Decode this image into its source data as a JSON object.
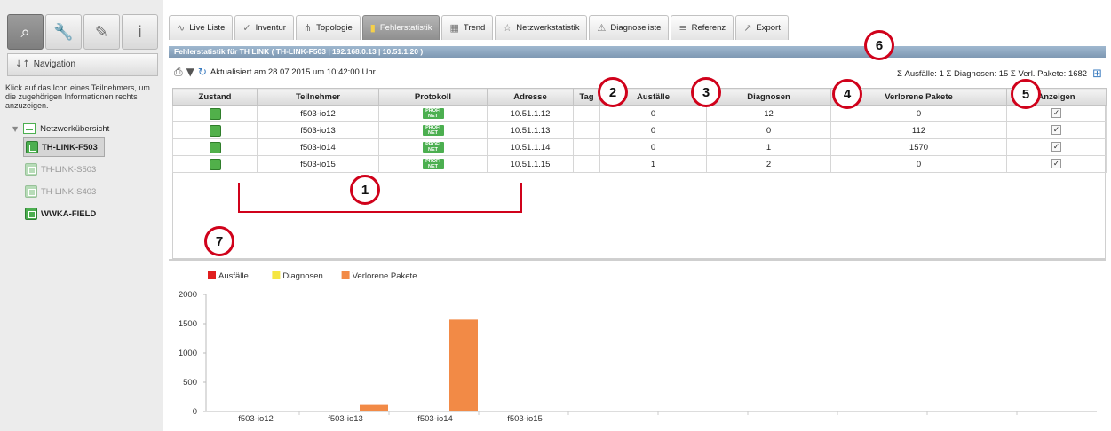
{
  "left_panel": {
    "tools": [
      {
        "icon": "search-icon",
        "glyph": "⌕"
      },
      {
        "icon": "wrench-icon",
        "glyph": "🔧"
      },
      {
        "icon": "tag-icon",
        "glyph": "✎"
      },
      {
        "icon": "info-icon",
        "glyph": "i"
      }
    ],
    "navigation_title": "Navigation",
    "hint": "Klick auf das Icon eines Teilnehmers, um die zugehörigen Informationen rechts anzuzeigen.",
    "tree_root": "Netzwerkübersicht",
    "nodes": [
      {
        "label": "TH-LINK-F503",
        "selected": true,
        "dim": false
      },
      {
        "label": "TH-LINK-S503",
        "selected": false,
        "dim": true
      },
      {
        "label": "TH-LINK-S403",
        "selected": false,
        "dim": true
      },
      {
        "label": "WWKA-FIELD",
        "selected": false,
        "dim": false
      }
    ]
  },
  "tabs": [
    {
      "label": "Live Liste",
      "icon": "pulse-icon",
      "glyph": "∿"
    },
    {
      "label": "Inventur",
      "icon": "inventory-icon",
      "glyph": "✓"
    },
    {
      "label": "Topologie",
      "icon": "topology-icon",
      "glyph": "⋔"
    },
    {
      "label": "Fehlerstatistik",
      "icon": "bar-chart-icon",
      "glyph": "▮",
      "active": true
    },
    {
      "label": "Trend",
      "icon": "trend-icon",
      "glyph": "▦"
    },
    {
      "label": "Netzwerkstatistik",
      "icon": "network-icon",
      "glyph": "☆"
    },
    {
      "label": "Diagnoseliste",
      "icon": "warning-icon",
      "glyph": "⚠"
    },
    {
      "label": "Referenz",
      "icon": "reference-icon",
      "glyph": "≡"
    },
    {
      "label": "Export",
      "icon": "export-icon",
      "glyph": "↗"
    }
  ],
  "title_bar": "Fehlerstatistik für TH LINK ( TH-LINK-F503 | 192.168.0.13 | 10.51.1.20 )",
  "toolbar": {
    "updated_text": "Aktualisiert am 28.07.2015 um 10:42:00 Uhr."
  },
  "summary": "Σ Ausfälle: 1 Σ Diagnosen: 15 Σ Verl. Pakete: 1682",
  "table": {
    "headers": [
      "Zustand",
      "Teilnehmer",
      "Protokoll",
      "Adresse",
      "Tag",
      "Ausfälle",
      "Diagnosen",
      "Verlorene Pakete",
      "Anzeigen"
    ],
    "protocol_badge": "PROFI NET",
    "rows": [
      {
        "teilnehmer": "f503-io12",
        "adresse": "10.51.1.12",
        "tag": "",
        "ausfaelle": "0",
        "diagnosen": "12",
        "verlorene": "0",
        "anzeigen": "✓"
      },
      {
        "teilnehmer": "f503-io13",
        "adresse": "10.51.1.13",
        "tag": "",
        "ausfaelle": "0",
        "diagnosen": "0",
        "verlorene": "112",
        "anzeigen": "✓"
      },
      {
        "teilnehmer": "f503-io14",
        "adresse": "10.51.1.14",
        "tag": "",
        "ausfaelle": "0",
        "diagnosen": "1",
        "verlorene": "1570",
        "anzeigen": "✓"
      },
      {
        "teilnehmer": "f503-io15",
        "adresse": "10.51.1.15",
        "tag": "",
        "ausfaelle": "1",
        "diagnosen": "2",
        "verlorene": "0",
        "anzeigen": "✓"
      }
    ]
  },
  "callouts": [
    "1",
    "2",
    "3",
    "4",
    "5",
    "6",
    "7"
  ],
  "colors": {
    "annotation_red": "#d0021b",
    "ausfaelle": "#e01e1e",
    "diagnosen": "#f5e642",
    "verlorene_pakete": "#f28a46",
    "status_green": "#51b04a"
  },
  "chart_data": {
    "type": "bar",
    "categories": [
      "f503-io12",
      "f503-io13",
      "f503-io14",
      "f503-io15"
    ],
    "series": [
      {
        "name": "Ausfälle",
        "values": [
          0,
          0,
          0,
          1
        ]
      },
      {
        "name": "Diagnosen",
        "values": [
          12,
          0,
          1,
          2
        ]
      },
      {
        "name": "Verlorene Pakete",
        "values": [
          0,
          112,
          1570,
          0
        ]
      }
    ],
    "yticks": [
      "0",
      "500",
      "1000",
      "1500",
      "2000"
    ],
    "ylim": [
      0,
      2000
    ],
    "legend": "top-left",
    "grid": false
  }
}
